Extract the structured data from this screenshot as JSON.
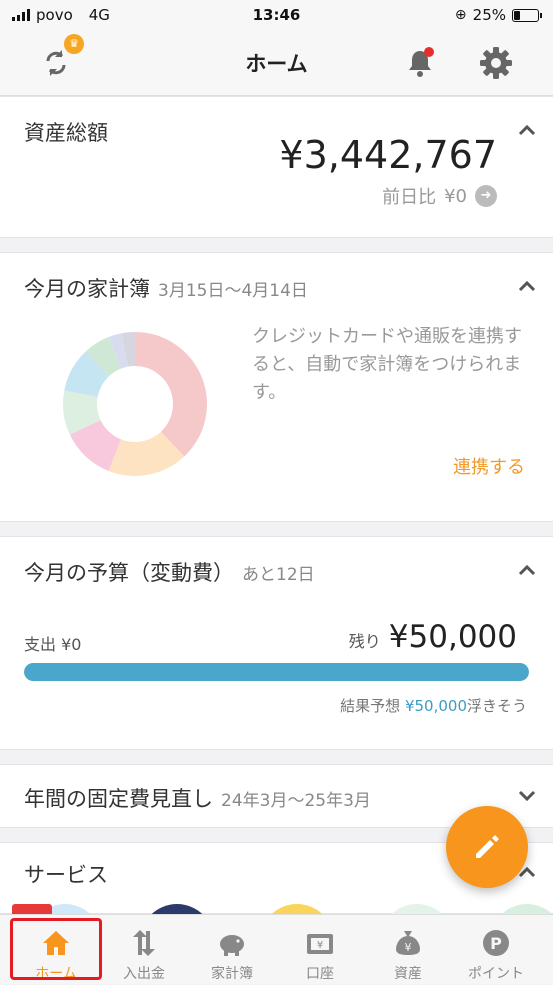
{
  "status_bar": {
    "carrier": "povo",
    "network": "4G",
    "time": "13:46",
    "battery": "25%"
  },
  "header": {
    "title": "ホーム",
    "sync_badge": "♛"
  },
  "assets": {
    "title": "資産総額",
    "total": "¥3,442,767",
    "diff_label": "前日比",
    "diff_value": "¥0"
  },
  "household": {
    "title": "今月の家計簿",
    "period": "3月15日〜4月14日",
    "note": "クレジットカードや通販を連携すると、自動で家計簿をつけられます。",
    "link": "連携する"
  },
  "budget": {
    "title": "今月の予算（変動費）",
    "days_left": "あと12日",
    "spent_label": "支出",
    "spent_value": "¥0",
    "remaining_label": "残り",
    "remaining_value": "¥50,000",
    "progress": 1.0,
    "forecast_prefix": "結果予想",
    "forecast_value": "¥50,000",
    "forecast_suffix": "浮きそう"
  },
  "fixed_costs": {
    "title": "年間の固定費見直し",
    "period": "24年3月〜25年3月"
  },
  "services": {
    "title": "サービス"
  },
  "tabs": [
    {
      "label": "ホーム",
      "icon": "home-icon",
      "active": true
    },
    {
      "label": "入出金",
      "icon": "transfer-icon"
    },
    {
      "label": "家計簿",
      "icon": "piggy-bank-icon"
    },
    {
      "label": "口座",
      "icon": "wallet-icon"
    },
    {
      "label": "資産",
      "icon": "money-bag-icon"
    },
    {
      "label": "ポイント",
      "icon": "points-icon"
    }
  ],
  "colors": {
    "accent": "#f7951d",
    "progress": "#4aa7cb",
    "link": "#f09a2b",
    "highlight": "#e51b23"
  },
  "donut_colors": [
    "#f5c8ca",
    "#fde3c2",
    "#f8c9dd",
    "#dcefe0",
    "#c6e5f2",
    "#cfe8d6",
    "#d9dcef",
    "#d6d6e0"
  ]
}
